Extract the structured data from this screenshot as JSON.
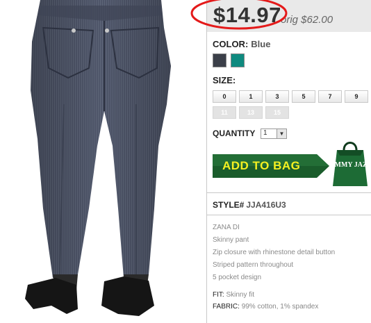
{
  "price": {
    "sale": "$14.97",
    "original": "orig $62.00"
  },
  "color": {
    "label": "COLOR:",
    "value": "Blue",
    "swatches": [
      "#3b3f49",
      "#0f8a7f"
    ]
  },
  "size": {
    "label": "SIZE:",
    "options": [
      {
        "value": "0",
        "available": true
      },
      {
        "value": "1",
        "available": true
      },
      {
        "value": "3",
        "available": true
      },
      {
        "value": "5",
        "available": true
      },
      {
        "value": "7",
        "available": true
      },
      {
        "value": "9",
        "available": true
      },
      {
        "value": "11",
        "available": false
      },
      {
        "value": "13",
        "available": false
      },
      {
        "value": "15",
        "available": false
      }
    ]
  },
  "quantity": {
    "label": "QUANTITY",
    "value": "1"
  },
  "cart": {
    "button_label": "ADD TO BAG",
    "brand_bag_text": "JIMMY JAZZ"
  },
  "style": {
    "label": "STYLE#",
    "code": "JJA416U3"
  },
  "description": [
    "ZANA DI",
    "Skinny pant",
    "Zip closure with rhinestone detail button",
    "Striped pattern throughout",
    "5 pocket design"
  ],
  "fit": {
    "label": "FIT:",
    "value": "Skinny fit"
  },
  "fabric": {
    "label": "FABRIC:",
    "value": "99% cotton, 1% spandex"
  }
}
